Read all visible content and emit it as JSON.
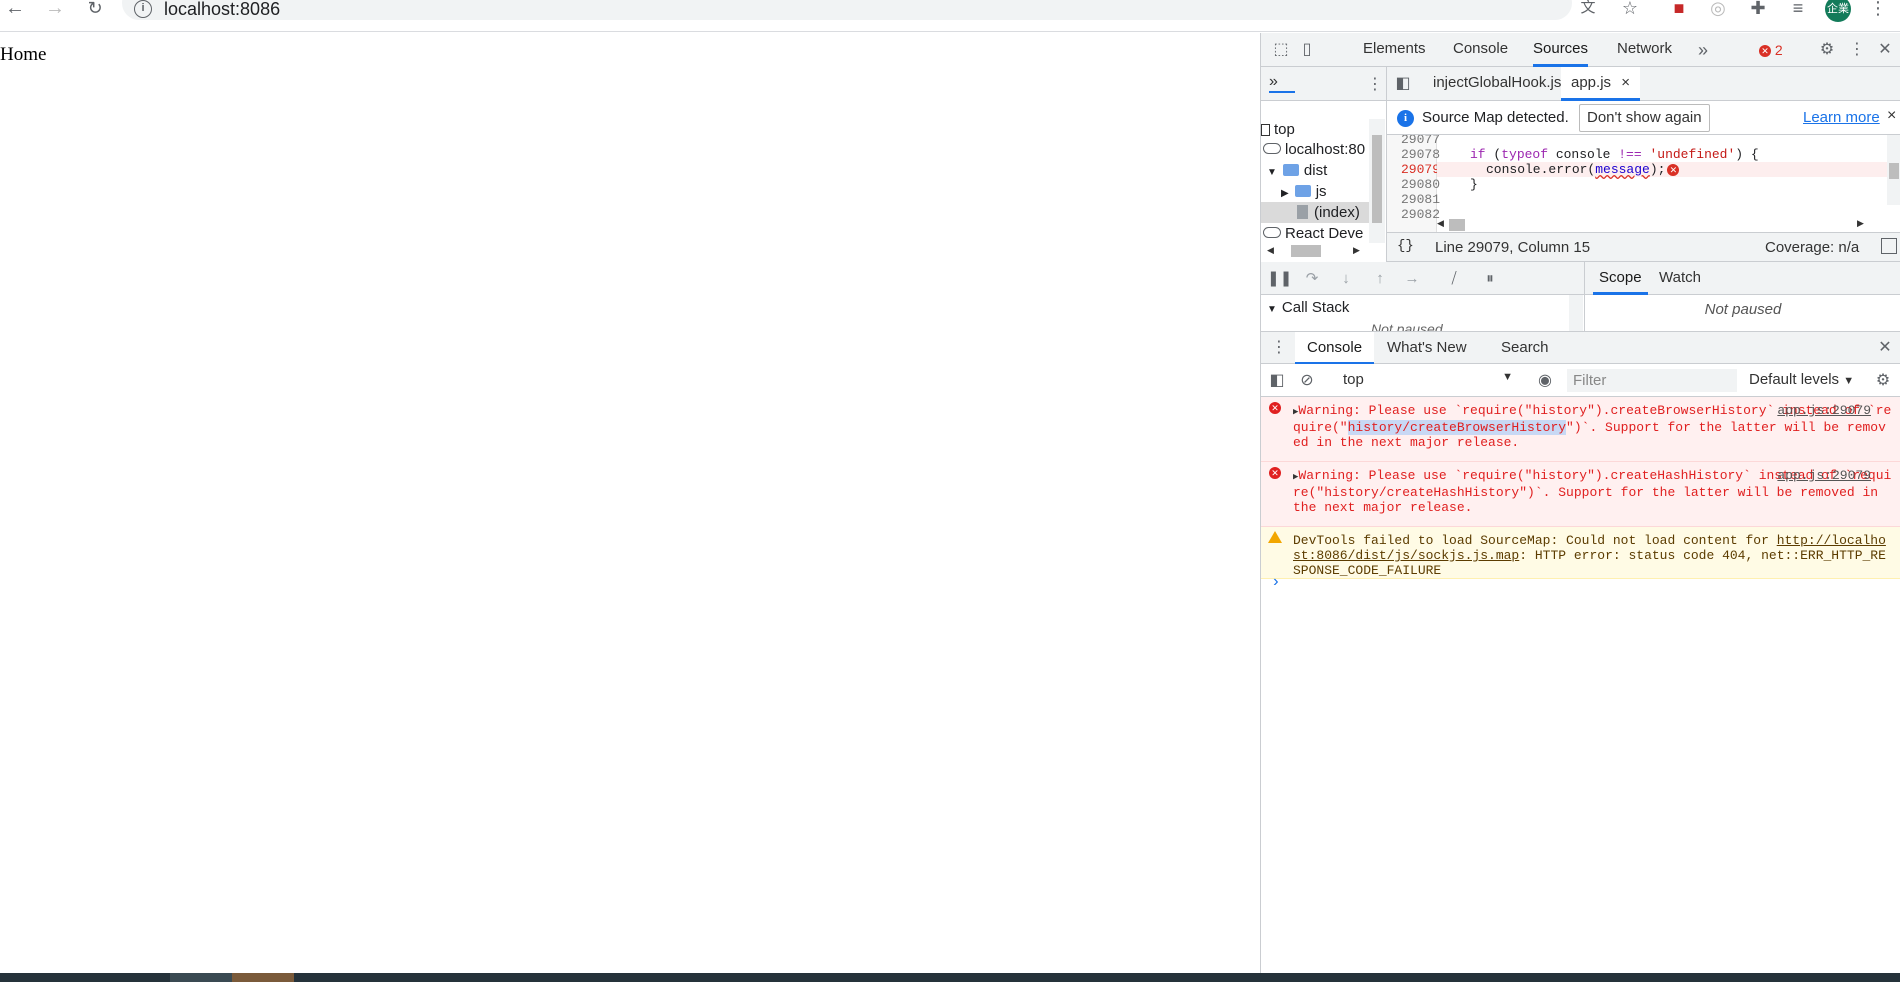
{
  "browser": {
    "url": "localhost:8086",
    "icons": [
      "back-arrow-icon",
      "forward-arrow-icon",
      "reload-icon",
      "site-info-icon",
      "translate-icon",
      "bookmark-star-icon",
      "extension-icon",
      "puzzle-icon",
      "reading-list-icon",
      "menu-dots-icon"
    ],
    "avatar_text": "企業"
  },
  "page": {
    "text": "Home"
  },
  "devtools": {
    "tabs": [
      "Elements",
      "Console",
      "Sources",
      "Network"
    ],
    "active_tab": "Sources",
    "error_count": "2",
    "navigator": {
      "items": [
        {
          "label": "top",
          "type": "frame"
        },
        {
          "label": "localhost:80",
          "type": "cloud"
        },
        {
          "label": "dist",
          "type": "folder"
        },
        {
          "label": "js",
          "type": "folder"
        },
        {
          "label": "(index)",
          "type": "file"
        },
        {
          "label": "React Deve",
          "type": "cloud"
        }
      ]
    },
    "editor_tabs": [
      {
        "label": "injectGlobalHook.js"
      },
      {
        "label": "app.js",
        "close": "×"
      }
    ],
    "infobar": {
      "message": "Source Map detected.",
      "button": "Don't show again",
      "link": "Learn more",
      "close": "×"
    },
    "code": {
      "line_numbers": [
        "29077",
        "29078",
        "29079",
        "29080",
        "29081",
        "29082"
      ],
      "line_78": {
        "kw_if": "if",
        "open": " (",
        "kw_typeof": "typeof",
        "mid": " console ",
        "op": "!==",
        "str": "'undefined'",
        "end": ") {"
      },
      "line_79": {
        "obj": "console",
        "method": ".error(",
        "arg": "message",
        "end": ");"
      },
      "line_80": "}"
    },
    "status": {
      "format_icon": "{}",
      "position": "Line 29079, Column 15",
      "coverage": "Coverage: n/a"
    },
    "call_stack": {
      "title": "Call Stack",
      "body": "Not paused"
    },
    "scope_tabs": [
      "Scope",
      "Watch"
    ],
    "scope_body": "Not paused",
    "drawer": {
      "tabs": [
        "Console",
        "What's New",
        "Search"
      ],
      "active_tab": "Console",
      "context": "top",
      "filter_placeholder": "Filter",
      "levels": "Default levels"
    },
    "messages": [
      {
        "level": "error",
        "part1": "Warning: Please use `require(\"history\").createBrowserHistory` instead of `require(\"",
        "highlight": "history/createBrowserHistory",
        "part2": "\")`. Support for the latter will be removed in the next major release.",
        "source": "app.js:29079"
      },
      {
        "level": "error",
        "part1": "Warning: Please use `require(\"history\").createHashHistory` instead of `require(\"history/createHashHistory\")`. Support for the latter will be removed in the next major release.",
        "source": "app.js:29079"
      },
      {
        "level": "warning",
        "part1": "DevTools failed to load SourceMap: Could not load content for ",
        "link": "http://localhost:8086/dist/js/sockjs.js.map",
        "part2": ": HTTP error: status code 404, net::ERR_HTTP_RESPONSE_CODE_FAILURE"
      }
    ],
    "prompt": "›"
  },
  "colors": {
    "accent": "#1a73e8",
    "error": "#e02020",
    "warning": "#f2a600"
  }
}
